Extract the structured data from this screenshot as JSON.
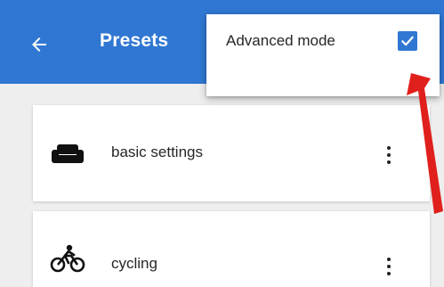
{
  "appbar": {
    "title": "Presets",
    "back_icon": "arrow-left-icon",
    "color": "#2f77d2"
  },
  "menu": {
    "advanced_mode": {
      "label": "Advanced mode",
      "checked": true,
      "icon": "checkbox-checked-icon"
    }
  },
  "presets": [
    {
      "label": "basic settings",
      "icon": "sofa-icon",
      "menu_icon": "more-vertical-icon"
    },
    {
      "label": "cycling",
      "icon": "cyclist-icon",
      "menu_icon": "more-vertical-icon"
    }
  ],
  "colors": {
    "accent": "#2f77d2",
    "annotation_arrow": "#e0201c",
    "background": "#eeeeee"
  }
}
